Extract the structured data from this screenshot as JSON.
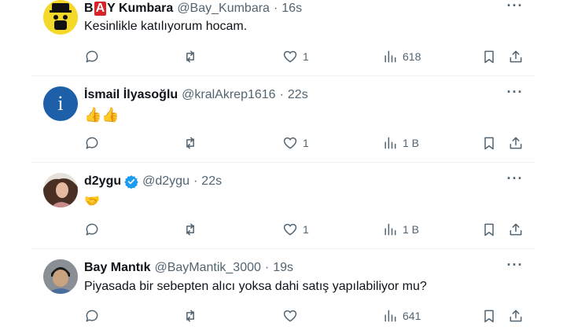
{
  "tweets": [
    {
      "name_pre": "B",
      "name_badge": "A",
      "name_post": "Y Kumbara",
      "handle": "@Bay_Kumbara",
      "sep": "·",
      "time": "16s",
      "text": "Kesinlikle katılıyorum hocam.",
      "likes": "1",
      "views": "618",
      "avatar": "smiley-avatar"
    },
    {
      "name": "İsmail İlyasoğlu",
      "handle": "@kralAkrep1616",
      "sep": "·",
      "time": "22s",
      "text": "👍👍",
      "likes": "1",
      "views": "1 B",
      "avatar": "letter-avatar",
      "avatar_letter": "i"
    },
    {
      "name": "d2ygu",
      "handle": "@d2ygu",
      "sep": "·",
      "time": "22s",
      "text": "🤝",
      "likes": "1",
      "views": "1 B",
      "avatar": "photo-avatar",
      "verified": true
    },
    {
      "name": "Bay Mantık",
      "handle": "@BayMantik_3000",
      "sep": "·",
      "time": "19s",
      "text": "Piyasada bir sebepten alıcı yoksa dahi satış yapılabiliyor mu?",
      "likes": "",
      "views": "641",
      "avatar": "photo-avatar"
    }
  ],
  "colors": {
    "text": "#0f1419",
    "muted": "#536471",
    "divider": "#eff3f4",
    "verified": "#1d9bf0",
    "avatar_blue": "#1d5fa8"
  },
  "icons": [
    "more-icon",
    "reply-icon",
    "retweet-icon",
    "like-icon",
    "views-icon",
    "bookmark-icon",
    "share-icon",
    "verified-icon"
  ]
}
